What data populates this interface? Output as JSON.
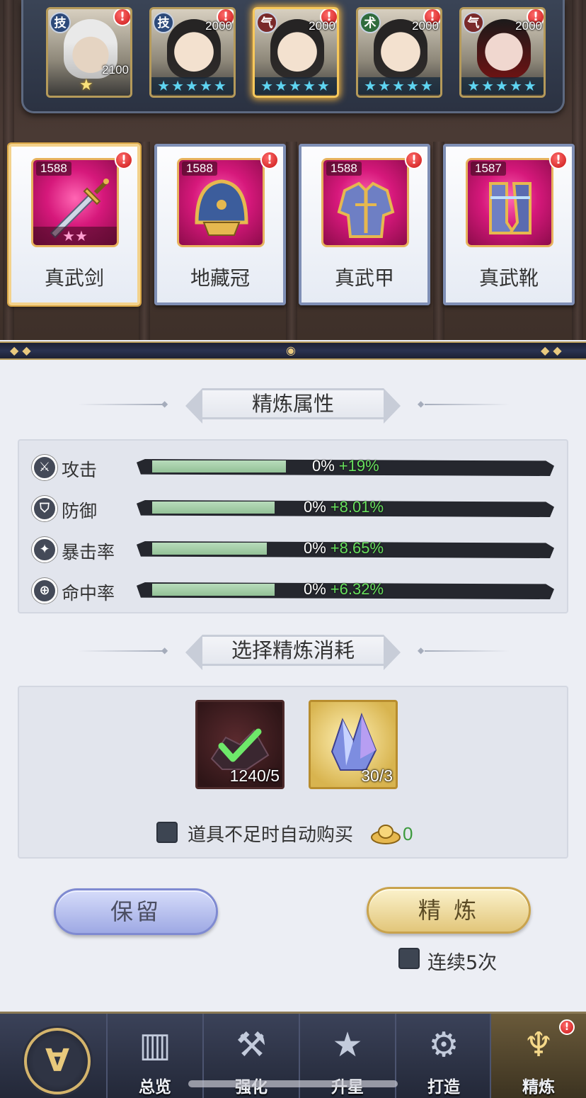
{
  "heroes": [
    {
      "tag": "技",
      "level": "2100",
      "alert": "!",
      "stars": "★"
    },
    {
      "tag": "技",
      "level": "2000",
      "alert": "!",
      "stars": "★★★★★"
    },
    {
      "tag": "气",
      "level": "2000",
      "alert": "!",
      "stars": "★★★★★"
    },
    {
      "tag": "术",
      "level": "2000",
      "alert": "!",
      "stars": "★★★★★"
    },
    {
      "tag": "气",
      "level": "2000",
      "alert": "!",
      "stars": "★★★★★"
    }
  ],
  "equipment": [
    {
      "name": "真武剑",
      "level": "1588",
      "alert": "!",
      "stars": "★★"
    },
    {
      "name": "地藏冠",
      "level": "1588",
      "alert": "!"
    },
    {
      "name": "真武甲",
      "level": "1588",
      "alert": "!"
    },
    {
      "name": "真武靴",
      "level": "1587",
      "alert": "!"
    }
  ],
  "refine_section": {
    "title": "精炼属性",
    "attributes": [
      {
        "icon": "attack-icon",
        "label": "攻击",
        "current": "0%",
        "gain": "+19%",
        "fill": 0.35
      },
      {
        "icon": "defense-icon",
        "label": "防御",
        "current": "0%",
        "gain": "+8.01%",
        "fill": 0.32
      },
      {
        "icon": "crit-icon",
        "label": "暴击率",
        "current": "0%",
        "gain": "+8.65%",
        "fill": 0.3
      },
      {
        "icon": "accuracy-icon",
        "label": "命中率",
        "current": "0%",
        "gain": "+6.32%",
        "fill": 0.32
      }
    ]
  },
  "cost_section": {
    "title": "选择精炼消耗",
    "items": [
      {
        "icon": "dark-ore-icon",
        "count": "1240/5",
        "checked": true
      },
      {
        "icon": "crystal-icon",
        "count": "30/3",
        "checked": false
      }
    ],
    "auto_buy_label": "道具不足时自动购买",
    "gold_amount": "0"
  },
  "buttons": {
    "keep": "保留",
    "refine": "精 炼",
    "repeat_label": "连续5次"
  },
  "nav": {
    "items": [
      {
        "label": "总览",
        "icon": "overview-icon"
      },
      {
        "label": "强化",
        "icon": "enhance-icon"
      },
      {
        "label": "升星",
        "icon": "star-up-icon"
      },
      {
        "label": "打造",
        "icon": "forge-icon"
      },
      {
        "label": "精炼",
        "icon": "refine-icon",
        "alert": "!"
      }
    ]
  },
  "colors": {
    "gain_green": "#68e05e",
    "bar_fill": "#a8d2ab",
    "alert_red": "#d92020",
    "gold": "#d4b46c"
  }
}
